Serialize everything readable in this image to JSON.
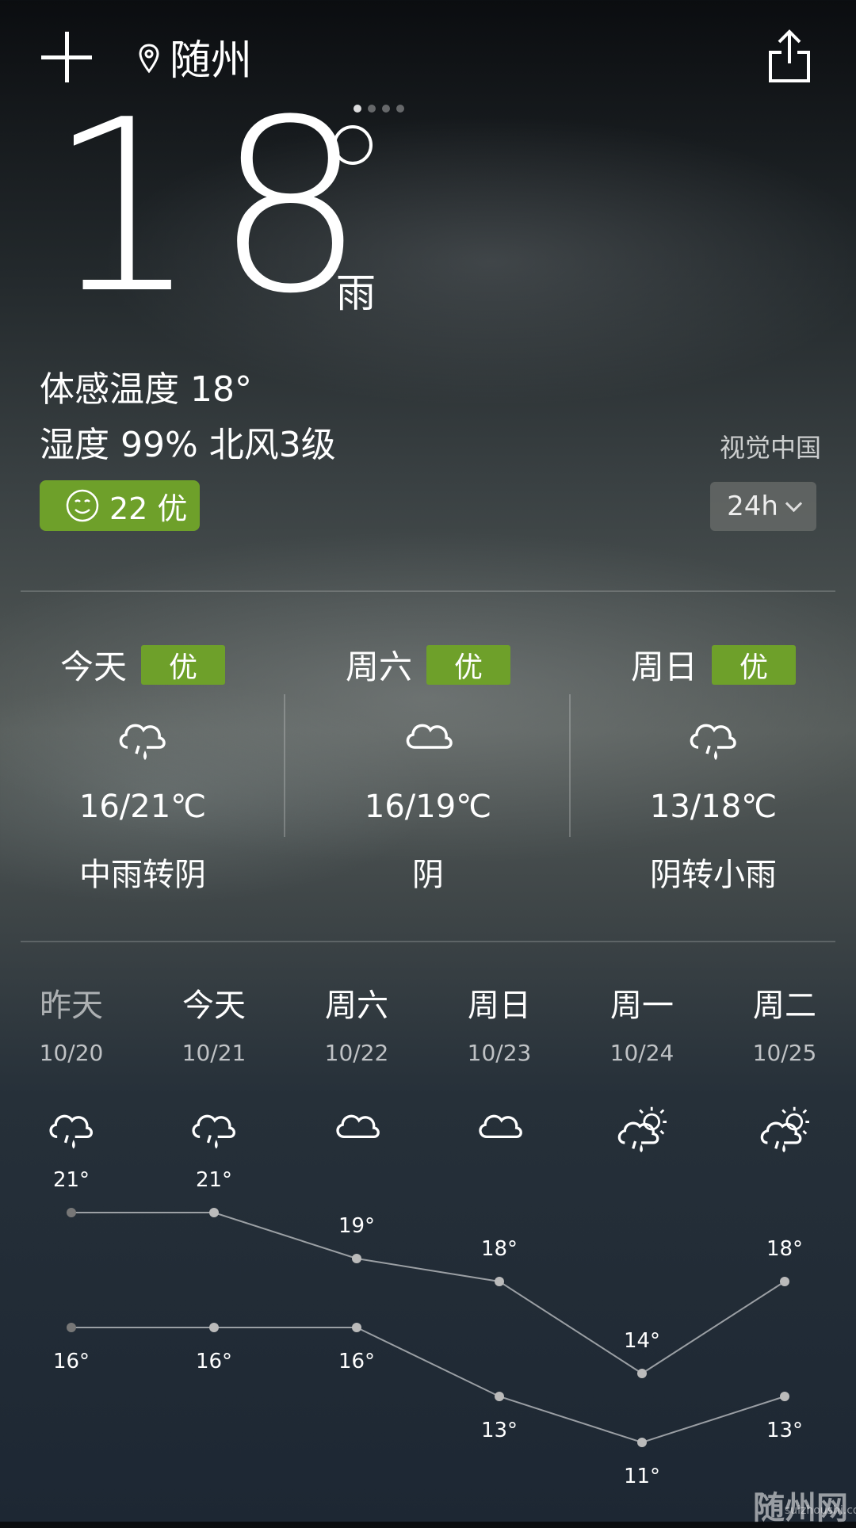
{
  "header": {
    "city": "随州",
    "page_count": 4,
    "active_page": 1
  },
  "current": {
    "temp": "18",
    "condition": "雨",
    "feels_like": "体感温度 18°",
    "humidity_wind": "湿度 99% 北风3级",
    "aqi": "22 优",
    "source": "视觉中国",
    "range_button": "24h"
  },
  "days": [
    {
      "name": "今天",
      "quality": "优",
      "icon": "rain-cloud-icon",
      "range": "16/21℃",
      "desc": "中雨转阴"
    },
    {
      "name": "周六",
      "quality": "优",
      "icon": "cloud-icon",
      "range": "16/19℃",
      "desc": "阴"
    },
    {
      "name": "周日",
      "quality": "优",
      "icon": "rain-cloud-icon",
      "range": "13/18℃",
      "desc": "阴转小雨"
    }
  ],
  "forecast": [
    {
      "day": "昨天",
      "date": "10/20",
      "icon": "rain-cloud-icon",
      "high": "21°",
      "low": "16°"
    },
    {
      "day": "今天",
      "date": "10/21",
      "icon": "rain-cloud-icon",
      "high": "21°",
      "low": "16°"
    },
    {
      "day": "周六",
      "date": "10/22",
      "icon": "cloud-icon",
      "high": "19°",
      "low": "16°"
    },
    {
      "day": "周日",
      "date": "10/23",
      "icon": "cloud-icon",
      "high": "18°",
      "low": "13°"
    },
    {
      "day": "周一",
      "date": "10/24",
      "icon": "sun-rain-cloud-icon",
      "high": "14°",
      "low": "11°"
    },
    {
      "day": "周二",
      "date": "10/25",
      "icon": "sun-rain-cloud-icon",
      "high": "18°",
      "low": "13°"
    }
  ],
  "chart_data": {
    "type": "line",
    "x": [
      "10/20",
      "10/21",
      "10/22",
      "10/23",
      "10/24",
      "10/25"
    ],
    "series": [
      {
        "values": [
          21,
          21,
          19,
          18,
          14,
          18
        ]
      },
      {
        "values": [
          16,
          16,
          16,
          13,
          11,
          13
        ]
      }
    ]
  },
  "watermark": {
    "title": "随州网",
    "sub": "suizhoushi.com"
  },
  "colors": {
    "accent_green": "#6ea02a"
  }
}
